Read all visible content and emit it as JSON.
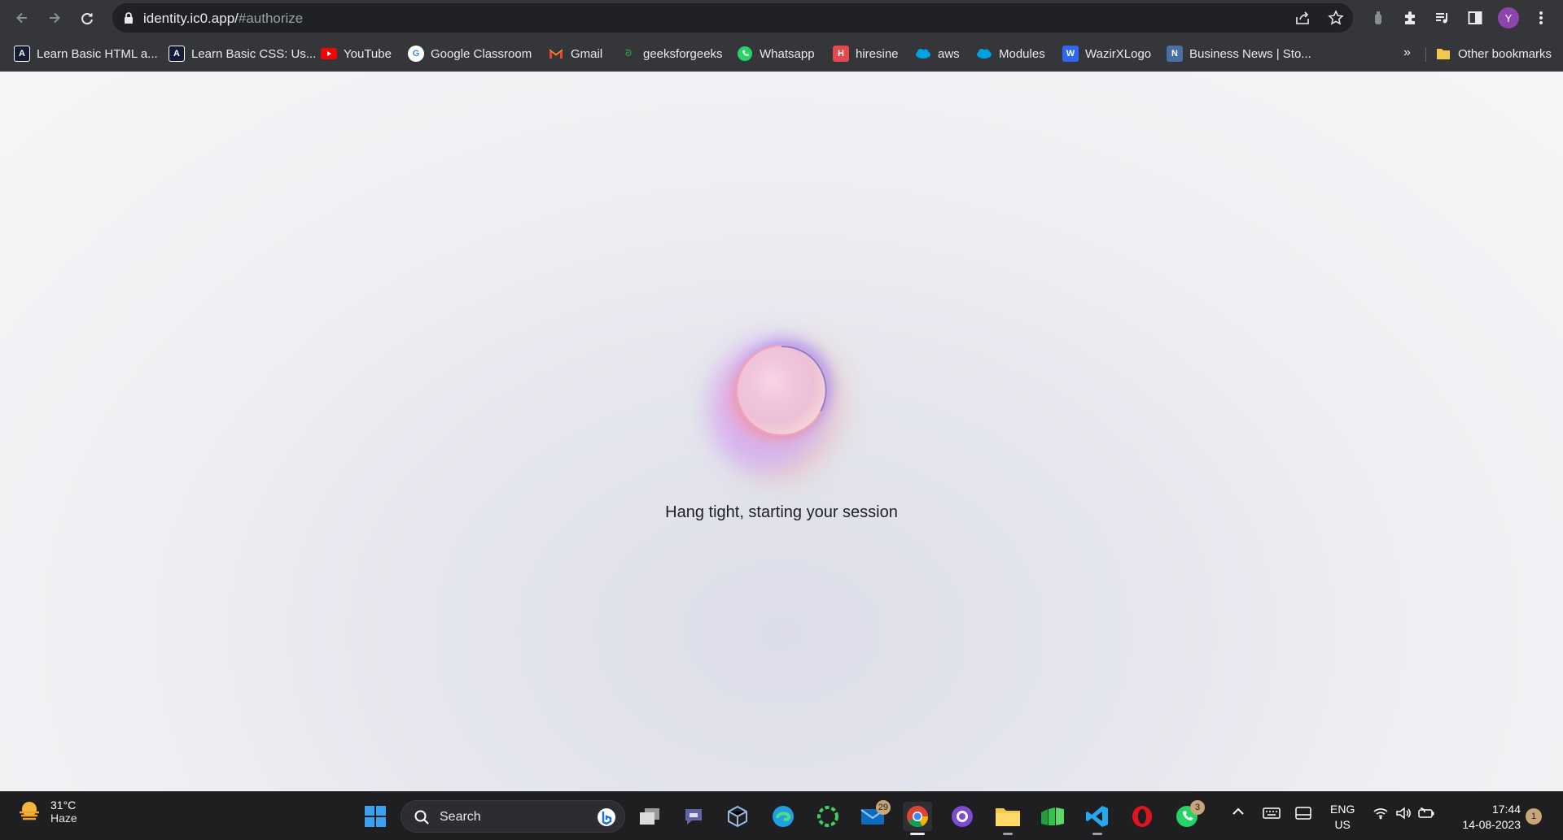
{
  "browser": {
    "url_host": "identity.ic0.app/",
    "url_path": "#authorize",
    "profile_initial": "Y"
  },
  "bookmarks": [
    {
      "label": "Learn Basic HTML a...",
      "icon": "codecademy-icon"
    },
    {
      "label": "Learn Basic CSS: Us...",
      "icon": "codecademy-icon"
    },
    {
      "label": "YouTube",
      "icon": "youtube-icon"
    },
    {
      "label": "Google Classroom",
      "icon": "google-icon"
    },
    {
      "label": "Gmail",
      "icon": "gmail-icon"
    },
    {
      "label": "geeksforgeeks",
      "icon": "geeksforgeeks-icon"
    },
    {
      "label": "Whatsapp",
      "icon": "whatsapp-icon"
    },
    {
      "label": "hiresine",
      "icon": "hiresine-icon"
    },
    {
      "label": "aws",
      "icon": "salesforce-cloud-icon"
    },
    {
      "label": "Modules",
      "icon": "salesforce-cloud-icon"
    },
    {
      "label": "WazirXLogo",
      "icon": "wazirx-icon"
    },
    {
      "label": "Business News | Sto...",
      "icon": "news-icon"
    }
  ],
  "bookmarks_overflow": "»",
  "other_bookmarks": "Other bookmarks",
  "page": {
    "status_text": "Hang tight, starting your session"
  },
  "taskbar": {
    "weather_temp": "31°C",
    "weather_condition": "Haze",
    "search_label": "Search",
    "mail_badge": "29",
    "whatsapp_badge": "3",
    "lang_top": "ENG",
    "lang_bottom": "US",
    "time": "17:44",
    "date": "14-08-2023",
    "notification_count": "1"
  },
  "colors": {
    "chrome_bar": "#35363a",
    "omnibox": "#202124",
    "taskbar": "#1f1f22",
    "profile": "#8e44ad"
  }
}
